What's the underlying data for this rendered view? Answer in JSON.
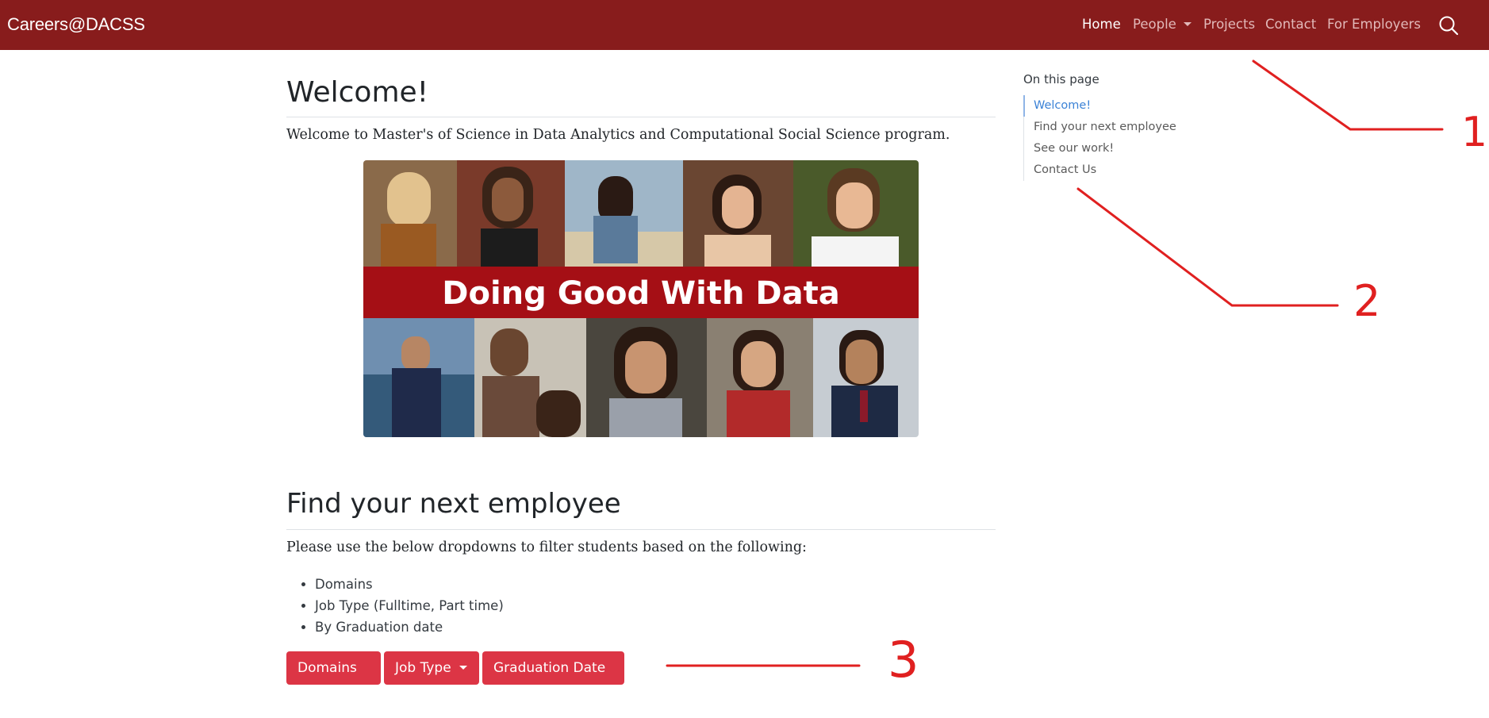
{
  "navbar": {
    "brand": "Careers@DACSS",
    "items": [
      {
        "label": "Home"
      },
      {
        "label": "People"
      },
      {
        "label": "Projects"
      },
      {
        "label": "Contact"
      },
      {
        "label": "For Employers"
      }
    ]
  },
  "main": {
    "welcome_heading": "Welcome!",
    "welcome_text": "Welcome to Master's of Science in Data Analytics and Computational Social Science program.",
    "banner_text": "Doing Good With Data",
    "employee_heading": "Find your next employee",
    "employee_text": "Please use the below dropdowns to filter students based on the following:",
    "bullets": [
      "Domains",
      "Job Type (Fulltime, Part time)",
      "By Graduation date"
    ],
    "dropdowns": [
      "Domains",
      "Job Type",
      "Graduation Date"
    ]
  },
  "toc": {
    "title": "On this page",
    "items": [
      "Welcome!",
      "Find your next employee",
      "See our work!",
      "Contact Us"
    ]
  },
  "annotations": {
    "label_1": "1",
    "label_2": "2",
    "label_3": "3"
  },
  "colors": {
    "navbar": "#881c1c",
    "button": "#dc3545",
    "annotation": "#e02020",
    "toc_active": "#3b82d6"
  }
}
